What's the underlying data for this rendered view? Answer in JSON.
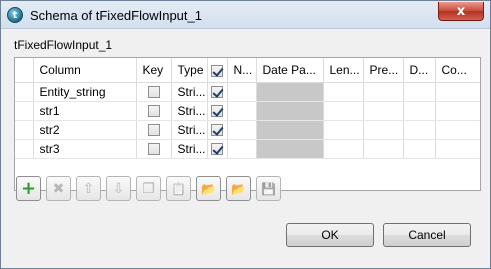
{
  "window": {
    "title": "Schema of tFixedFlowInput_1",
    "app_icon_glyph": "t",
    "close_glyph": "x"
  },
  "component_label": "tFixedFlowInput_1",
  "table": {
    "headers": {
      "column": "Column",
      "key": "Key",
      "type": "Type",
      "nullable_label": "N...",
      "date_pattern": "Date Pa...",
      "length": "Len...",
      "precision": "Pre...",
      "default": "D...",
      "comment": "Co..."
    },
    "nullable_header_checked": true,
    "rows": [
      {
        "column": "Entity_string",
        "key": false,
        "type": "Stri...",
        "nullable": true,
        "date_pattern": "",
        "length": "",
        "precision": "",
        "default": "",
        "comment": ""
      },
      {
        "column": "str1",
        "key": false,
        "type": "Stri...",
        "nullable": true,
        "date_pattern": "",
        "length": "",
        "precision": "",
        "default": "",
        "comment": ""
      },
      {
        "column": "str2",
        "key": false,
        "type": "Stri...",
        "nullable": true,
        "date_pattern": "",
        "length": "",
        "precision": "",
        "default": "",
        "comment": ""
      },
      {
        "column": "str3",
        "key": false,
        "type": "Stri...",
        "nullable": true,
        "date_pattern": "",
        "length": "",
        "precision": "",
        "default": "",
        "comment": ""
      }
    ]
  },
  "toolbar": {
    "buttons": [
      {
        "name": "add",
        "icon": "plus-icon",
        "glyph": "+",
        "enabled": true,
        "color": "#2f9a2f"
      },
      {
        "name": "remove",
        "icon": "delete-icon",
        "glyph": "✖",
        "enabled": false,
        "color": "#b8b8b8"
      },
      {
        "name": "move-up",
        "icon": "arrow-up-icon",
        "glyph": "⇧",
        "enabled": false,
        "color": "#b8b8b8"
      },
      {
        "name": "move-down",
        "icon": "arrow-down-icon",
        "glyph": "⇩",
        "enabled": false,
        "color": "#b8b8b8"
      },
      {
        "name": "copy",
        "icon": "copy-icon",
        "glyph": "❐",
        "enabled": false,
        "color": "#b8b8b8"
      },
      {
        "name": "paste",
        "icon": "paste-icon",
        "glyph": "📋",
        "enabled": false,
        "color": "#b8b8b8"
      },
      {
        "name": "import",
        "icon": "import-schema-icon",
        "glyph": "📂",
        "enabled": true,
        "color": "#d49a1f"
      },
      {
        "name": "export",
        "icon": "export-schema-icon",
        "glyph": "📂",
        "enabled": true,
        "color": "#3a78c9"
      },
      {
        "name": "save",
        "icon": "save-icon",
        "glyph": "💾",
        "enabled": false,
        "color": "#b8b8b8"
      }
    ]
  },
  "buttons": {
    "ok": "OK",
    "cancel": "Cancel"
  }
}
